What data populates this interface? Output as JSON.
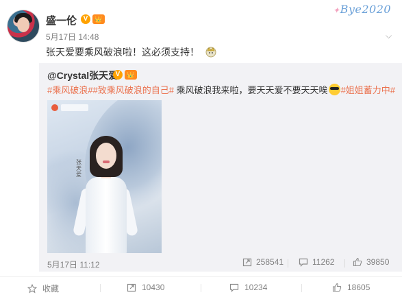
{
  "post": {
    "author": "盛一伦",
    "verified_mark": "V",
    "crown_mark": "👑",
    "decoration_text": "Bye2020",
    "time": "5月17日 14:48",
    "caret": "⌵",
    "text": "张天爱要乘风破浪啦！这必须支持！"
  },
  "repost": {
    "author": "@Crystal张天爱",
    "verified_mark": "V",
    "crown_mark": "👑",
    "topic1": "#乘风破浪#",
    "topic2": "#致乘风破浪的自己#",
    "body1": " 乘风破浪我来啦，要天天爱不要天天唉",
    "topic3": "#姐姐蓄力中#",
    "photo_caption": "张天爱",
    "time": "5月17日 11:12",
    "forwards": "258541",
    "comments": "11262",
    "likes": "39850"
  },
  "footer": {
    "favorite": "收藏",
    "forwards": "10430",
    "comments": "10234",
    "likes": "18605"
  },
  "colors": {
    "topic": "#eb7350",
    "muted": "#808080",
    "repost_bg": "#f2f2f5",
    "verified": "#ffa200"
  }
}
